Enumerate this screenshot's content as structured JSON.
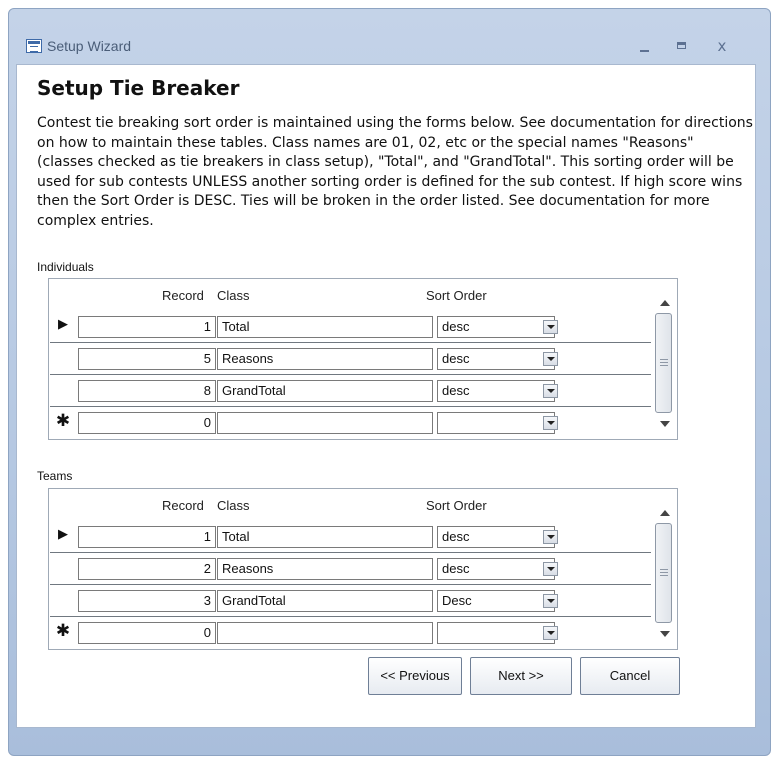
{
  "window": {
    "title": "Setup Wizard",
    "minimize_glyph": "",
    "maximize_glyph": "",
    "close_glyph": "x"
  },
  "heading": "Setup Tie Breaker",
  "description": "Contest tie breaking sort order is maintained using the forms below.  See documentation for directions on how to maintain these tables.   Class names are 01, 02, etc or the special names \"Reasons\" (classes checked as tie breakers in class setup), \"Total\", and \"GrandTotal\".  This sorting order will be used for sub contests UNLESS another sorting order is defined for the sub contest. If high score wins then the Sort Order is DESC. Ties will be broken in the order listed.  See documentation for more complex entries.",
  "individuals": {
    "label": "Individuals",
    "columns": {
      "record": "Record",
      "class": "Class",
      "sort_order": "Sort Order"
    },
    "rows": [
      {
        "selector": "▶",
        "record": "1",
        "class": "Total",
        "sort_order": "desc"
      },
      {
        "selector": "",
        "record": "5",
        "class": "Reasons",
        "sort_order": "desc"
      },
      {
        "selector": "",
        "record": "8",
        "class": "GrandTotal",
        "sort_order": "desc"
      },
      {
        "selector": "✱",
        "record": "0",
        "class": "",
        "sort_order": ""
      }
    ]
  },
  "teams": {
    "label": "Teams",
    "columns": {
      "record": "Record",
      "class": "Class",
      "sort_order": "Sort Order"
    },
    "rows": [
      {
        "selector": "▶",
        "record": "1",
        "class": "Total",
        "sort_order": "desc"
      },
      {
        "selector": "",
        "record": "2",
        "class": "Reasons",
        "sort_order": "desc"
      },
      {
        "selector": "",
        "record": "3",
        "class": "GrandTotal",
        "sort_order": "Desc"
      },
      {
        "selector": "✱",
        "record": "0",
        "class": "",
        "sort_order": ""
      }
    ]
  },
  "buttons": {
    "previous": "<< Previous",
    "next": "Next >>",
    "cancel": "Cancel"
  }
}
